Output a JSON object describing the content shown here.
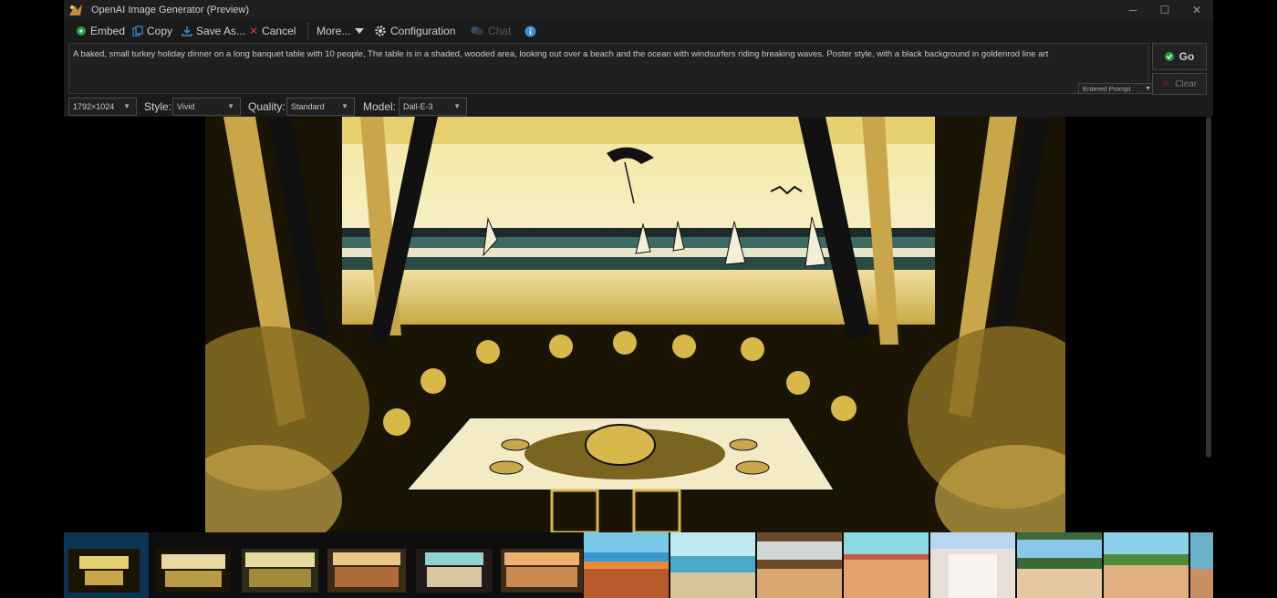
{
  "window": {
    "title": "OpenAI Image Generator (Preview)",
    "controls": {
      "minimize": "─",
      "maximize": "☐",
      "close": "✕"
    }
  },
  "toolbar": {
    "embed": "Embed",
    "copy": "Copy",
    "save_as": "Save As...",
    "cancel": "Cancel",
    "more": "More...",
    "configuration": "Configuration",
    "chat": "Chat"
  },
  "prompt": {
    "text": "A baked, small turkey holiday dinner on a long banquet table with 10 people, The table is in a shaded, wooded area, looking out over a beach and the ocean with windsurfers riding breaking waves. Poster style, with a black background in goldenrod line art",
    "type_selector": "Entered Prompt"
  },
  "actions": {
    "go": "Go",
    "clear": "Clear"
  },
  "options": {
    "size": "1792×1024",
    "style_label": "Style:",
    "style": "Vivid",
    "quality_label": "Quality:",
    "quality": "Standard",
    "model_label": "Model:",
    "model": "Dall-E-3"
  },
  "colors": {
    "accent_blue": "#3a8fd6",
    "go_green": "#2e9e44",
    "cancel_red": "#d43a3a",
    "gold": "#d9b84a"
  },
  "icons": {
    "embed": "embed-icon",
    "copy": "copy-icon",
    "save": "save-icon",
    "cancel": "cancel-x-icon",
    "more": "chevron-down-icon",
    "configuration": "gear-icon",
    "chat": "chat-bubbles-icon",
    "info": "info-icon"
  }
}
